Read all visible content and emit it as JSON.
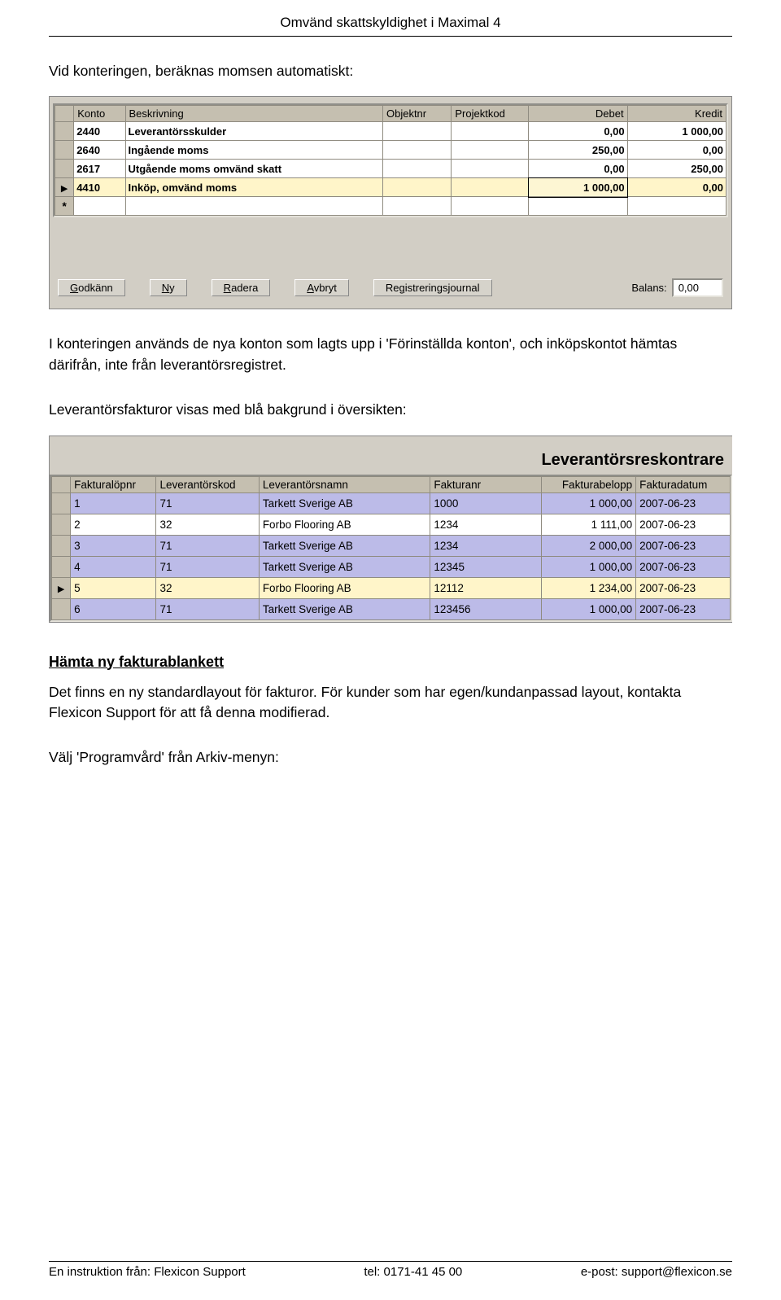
{
  "doc_header": "Omvänd skattskyldighet i Maximal 4",
  "p1": "Vid konteringen, beräknas momsen automatiskt:",
  "kontering": {
    "headers": {
      "konto": "Konto",
      "beskrivning": "Beskrivning",
      "objektnr": "Objektnr",
      "projektkod": "Projektkod",
      "debet": "Debet",
      "kredit": "Kredit"
    },
    "rows": [
      {
        "marker": "",
        "konto": "2440",
        "beskrivning": "Leverantörsskulder",
        "objektnr": "",
        "projektkod": "",
        "debet": "0,00",
        "kredit": "1 000,00",
        "style": "white",
        "bold": true
      },
      {
        "marker": "",
        "konto": "2640",
        "beskrivning": "Ingående moms",
        "objektnr": "",
        "projektkod": "",
        "debet": "250,00",
        "kredit": "0,00",
        "style": "white",
        "bold": true
      },
      {
        "marker": "",
        "konto": "2617",
        "beskrivning": "Utgående moms omvänd skatt",
        "objektnr": "",
        "projektkod": "",
        "debet": "0,00",
        "kredit": "250,00",
        "style": "white",
        "bold": true
      },
      {
        "marker": "▶",
        "konto": "4410",
        "beskrivning": "Inköp, omvänd moms",
        "objektnr": "",
        "projektkod": "",
        "debet": "1 000,00",
        "kredit": "0,00",
        "style": "yellow",
        "bold": true,
        "activeDebet": true
      }
    ],
    "new_marker": "*",
    "buttons": {
      "godkann": "Godkänn",
      "ny": "Ny",
      "radera": "Radera",
      "avbryt": "Avbryt",
      "regjournal": "Registreringsjournal"
    },
    "balance_label": "Balans:",
    "balance_value": "0,00"
  },
  "p2": "I konteringen används de nya konton som lagts upp i 'Förinställda konton', och inköpskontot hämtas därifrån, inte från leverantörsregistret.",
  "p3": "Leverantörsfakturor visas med blå bakgrund i översikten:",
  "reskontra": {
    "title": "Leverantörsreskontrare",
    "headers": {
      "lopnr": "Fakturalöpnr",
      "levkod": "Leverantörskod",
      "levnamn": "Leverantörsnamn",
      "fakturanr": "Fakturanr",
      "belopp": "Fakturabelopp",
      "datum": "Fakturadatum"
    },
    "rows": [
      {
        "marker": "",
        "lopnr": "1",
        "levkod": "71",
        "levnamn": "Tarkett Sverige AB",
        "fakturanr": "1000",
        "belopp": "1 000,00",
        "datum": "2007-06-23",
        "style": "blue"
      },
      {
        "marker": "",
        "lopnr": "2",
        "levkod": "32",
        "levnamn": "Forbo Flooring AB",
        "fakturanr": "1234",
        "belopp": "1 111,00",
        "datum": "2007-06-23",
        "style": "white"
      },
      {
        "marker": "",
        "lopnr": "3",
        "levkod": "71",
        "levnamn": "Tarkett Sverige AB",
        "fakturanr": "1234",
        "belopp": "2 000,00",
        "datum": "2007-06-23",
        "style": "blue"
      },
      {
        "marker": "",
        "lopnr": "4",
        "levkod": "71",
        "levnamn": "Tarkett Sverige AB",
        "fakturanr": "12345",
        "belopp": "1 000,00",
        "datum": "2007-06-23",
        "style": "blue"
      },
      {
        "marker": "▶",
        "lopnr": "5",
        "levkod": "32",
        "levnamn": "Forbo Flooring AB",
        "fakturanr": "12112",
        "belopp": "1 234,00",
        "datum": "2007-06-23",
        "style": "yellow"
      },
      {
        "marker": "",
        "lopnr": "6",
        "levkod": "71",
        "levnamn": "Tarkett Sverige AB",
        "fakturanr": "123456",
        "belopp": "1 000,00",
        "datum": "2007-06-23",
        "style": "blue"
      }
    ]
  },
  "heading1": "Hämta ny fakturablankett",
  "p4": "Det finns en ny standardlayout för fakturor. För kunder som har egen/kundanpassad layout, kontakta Flexicon Support för att få denna modifierad.",
  "p5": "Välj 'Programvård' från Arkiv-menyn:",
  "footer": {
    "left": "En instruktion från: Flexicon Support",
    "mid": "tel: 0171-41 45 00",
    "right": "e-post: support@flexicon.se"
  }
}
